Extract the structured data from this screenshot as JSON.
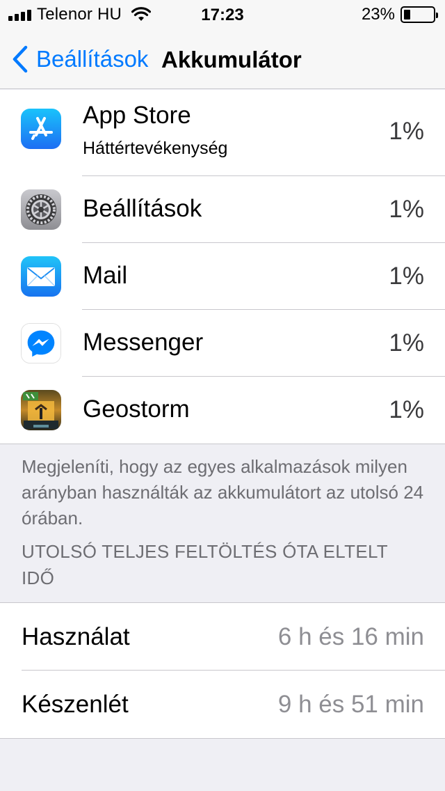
{
  "status_bar": {
    "carrier": "Telenor HU",
    "time": "17:23",
    "battery_percent": "23%",
    "battery_level": 0.23,
    "icons": [
      "signal-icon",
      "wifi-icon",
      "battery-icon"
    ]
  },
  "nav": {
    "back_label": "Beállítások",
    "title": "Akkumulátor"
  },
  "apps": [
    {
      "name": "App Store",
      "subtitle": "Háttértevékenység",
      "percent": "1%",
      "icon": "app-store-icon"
    },
    {
      "name": "Beállítások",
      "percent": "1%",
      "icon": "settings-gear-icon"
    },
    {
      "name": "Mail",
      "percent": "1%",
      "icon": "mail-icon"
    },
    {
      "name": "Messenger",
      "percent": "1%",
      "icon": "messenger-icon"
    },
    {
      "name": "Geostorm",
      "percent": "1%",
      "icon": "geostorm-icon"
    }
  ],
  "footer_note": "Megjeleníti, hogy az egyes alkalmazások milyen arányban használták az akkumulátort az utolsó 24 órában.",
  "section_header": "UTOLSÓ TELJES FELTÖLTÉS ÓTA ELTELT IDŐ",
  "usage": [
    {
      "label": "Használat",
      "value": "6 h és 16 min"
    },
    {
      "label": "Készenlét",
      "value": "9 h és 51 min"
    }
  ],
  "colors": {
    "accent": "#007aff",
    "background": "#efeff4",
    "secondary_text": "#8e8e93"
  }
}
